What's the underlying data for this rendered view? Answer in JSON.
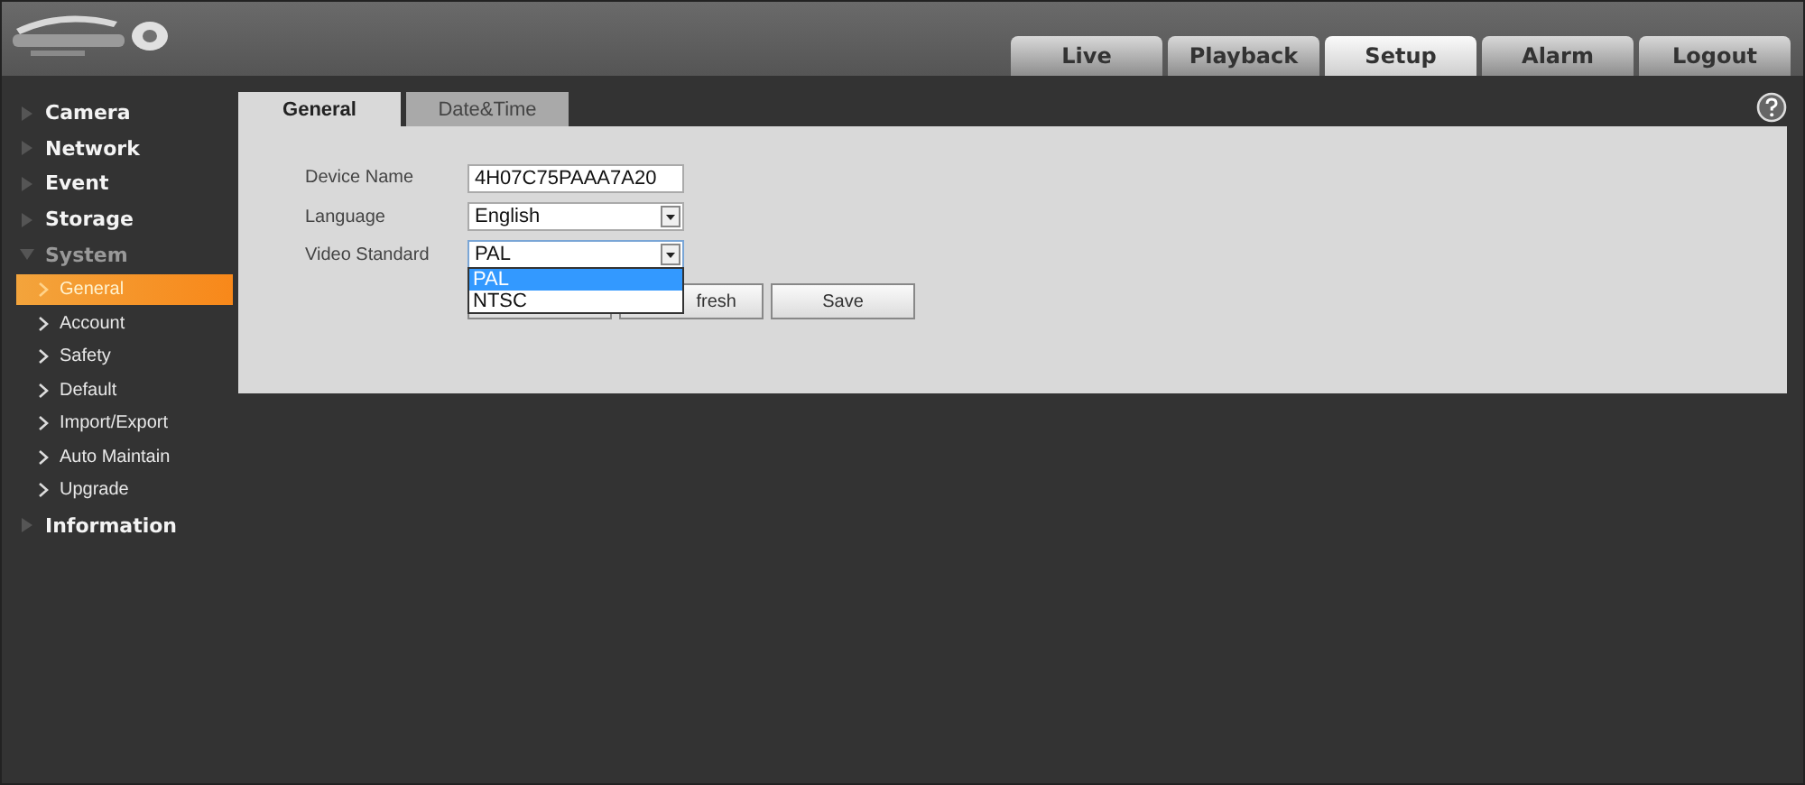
{
  "nav_tabs": [
    {
      "label": "Live",
      "selected": false
    },
    {
      "label": "Playback",
      "selected": false
    },
    {
      "label": "Setup",
      "selected": true
    },
    {
      "label": "Alarm",
      "selected": false
    },
    {
      "label": "Logout",
      "selected": false
    }
  ],
  "sidebar": {
    "items": [
      {
        "label": "Camera",
        "expanded": false
      },
      {
        "label": "Network",
        "expanded": false
      },
      {
        "label": "Event",
        "expanded": false
      },
      {
        "label": "Storage",
        "expanded": false
      },
      {
        "label": "System",
        "expanded": true,
        "children": [
          {
            "label": "General",
            "selected": true
          },
          {
            "label": "Account",
            "selected": false
          },
          {
            "label": "Safety",
            "selected": false
          },
          {
            "label": "Default",
            "selected": false
          },
          {
            "label": "Import/Export",
            "selected": false
          },
          {
            "label": "Auto Maintain",
            "selected": false
          },
          {
            "label": "Upgrade",
            "selected": false
          }
        ]
      },
      {
        "label": "Information",
        "expanded": false
      }
    ]
  },
  "tabs": [
    {
      "label": "General",
      "selected": true
    },
    {
      "label": "Date&Time",
      "selected": false
    }
  ],
  "form": {
    "fields": [
      {
        "kind": "text",
        "label": "Device Name",
        "value": "4H07C75PAAA7A20"
      },
      {
        "kind": "select",
        "label": "Language",
        "value": "English"
      },
      {
        "kind": "select",
        "label": "Video Standard",
        "value": "PAL",
        "open": true,
        "options": [
          {
            "label": "PAL",
            "selected": true
          },
          {
            "label": "NTSC",
            "selected": false
          }
        ]
      }
    ],
    "buttons": [
      {
        "label": "fresh"
      },
      {
        "label": "Save"
      }
    ]
  }
}
